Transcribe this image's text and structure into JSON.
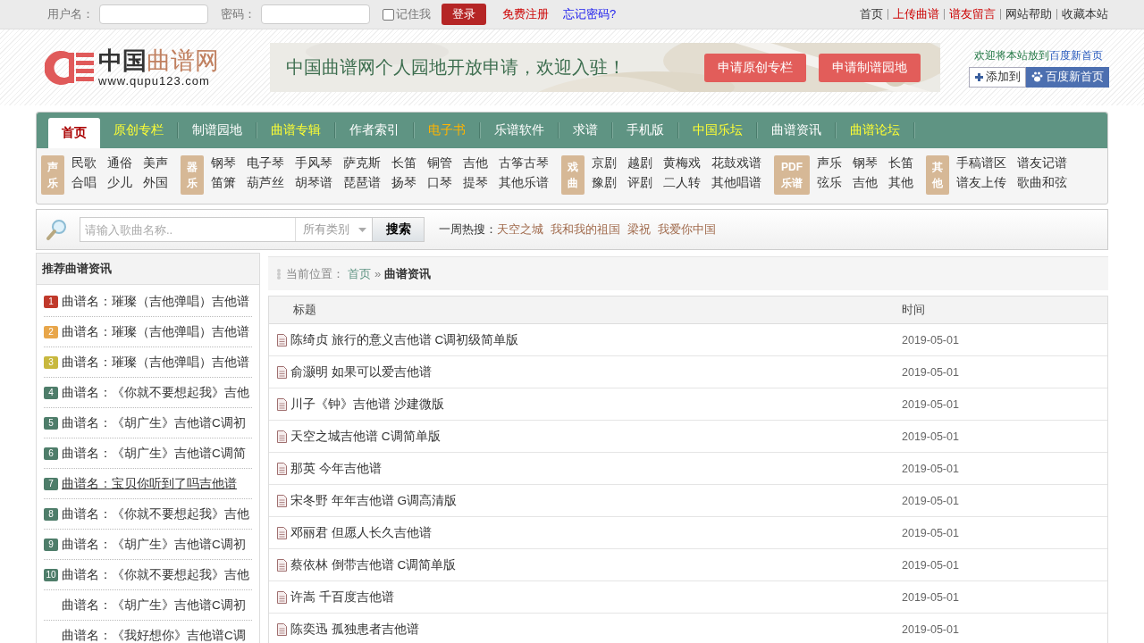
{
  "login_bar": {
    "username_label": "用户名：",
    "password_label": "密码：",
    "remember": {
      "label": "记住我",
      "checked": false
    },
    "login_button": "登录",
    "register_link": "免费注册",
    "forgot_link": "忘记密码?",
    "top_links": [
      {
        "label": "首页",
        "color": "#333333"
      },
      {
        "label": "上传曲谱",
        "color": "#cc0000"
      },
      {
        "label": "谱友留言",
        "color": "#cc0000"
      },
      {
        "label": "网站帮助",
        "color": "#333333"
      },
      {
        "label": "收藏本站",
        "color": "#333333"
      }
    ]
  },
  "header": {
    "logo_cn_1": "中国",
    "logo_cn_2": "曲谱网",
    "logo_url": "www.qupu123.com",
    "banner_text": "中国曲谱网个人园地开放申请，欢迎入驻！",
    "banner_buttons": [
      "申请原创专栏",
      "申请制谱园地"
    ],
    "homepage_text": "欢迎将本站放到",
    "homepage_link": "百度新首页",
    "add_button": "添加到",
    "baidu_button": "百度新首页"
  },
  "nav": [
    {
      "label": "首页",
      "selected": true,
      "color": "#aa0000"
    },
    {
      "label": "原创专栏",
      "selected": false,
      "color": "#ffff33"
    },
    {
      "label": "制谱园地",
      "selected": false,
      "color": "#ffffff"
    },
    {
      "label": "曲谱专辑",
      "selected": false,
      "color": "#ffff33"
    },
    {
      "label": "作者索引",
      "selected": false,
      "color": "#ffffff"
    },
    {
      "label": "电子书",
      "selected": false,
      "color": "#ffb400"
    },
    {
      "label": "乐谱软件",
      "selected": false,
      "color": "#ffffff"
    },
    {
      "label": "求谱",
      "selected": false,
      "color": "#ffffff"
    },
    {
      "label": "手机版",
      "selected": false,
      "color": "#ffffff"
    },
    {
      "label": "中国乐坛",
      "selected": false,
      "color": "#ffff33"
    },
    {
      "label": "曲谱资讯",
      "selected": false,
      "color": "#ffffff"
    },
    {
      "label": "曲谱论坛",
      "selected": false,
      "color": "#ffff33"
    }
  ],
  "categories": [
    {
      "label": [
        "声",
        "乐"
      ],
      "rows": [
        [
          "民歌",
          "通俗",
          "美声"
        ],
        [
          "合唱",
          "少儿",
          "外国"
        ]
      ]
    },
    {
      "label": [
        "器",
        "乐"
      ],
      "rows": [
        [
          "钢琴",
          "电子琴",
          "手风琴",
          "萨克斯",
          "长笛",
          "铜管",
          "吉他",
          "古筝古琴"
        ],
        [
          "笛箫",
          "葫芦丝",
          "胡琴谱",
          "琵琶谱",
          "扬琴",
          "口琴",
          "提琴",
          "其他乐谱"
        ]
      ]
    },
    {
      "label": [
        "戏",
        "曲"
      ],
      "rows": [
        [
          "京剧",
          "越剧",
          "黄梅戏",
          "花鼓戏谱"
        ],
        [
          "豫剧",
          "评剧",
          "二人转",
          "其他唱谱"
        ]
      ]
    },
    {
      "label": [
        "PDF",
        "乐谱"
      ],
      "rows": [
        [
          "声乐",
          "钢琴",
          "长笛"
        ],
        [
          "弦乐",
          "吉他",
          "其他"
        ]
      ]
    },
    {
      "label": [
        "其",
        "他"
      ],
      "rows": [
        [
          "手稿谱区",
          "谱友记谱"
        ],
        [
          "谱友上传",
          "歌曲和弦"
        ]
      ]
    }
  ],
  "search": {
    "placeholder": "请输入歌曲名称..",
    "category": "所有类别",
    "button": "搜索",
    "hot_label": "一周热搜：",
    "hot": [
      "天空之城",
      "我和我的祖国",
      "梁祝",
      "我爱你中国"
    ]
  },
  "sidebar": {
    "title": "推荐曲谱资讯",
    "items": [
      {
        "rank": "1",
        "color": "#c0392b",
        "text": "曲谱名：璀璨（吉他弹唱）吉他谱",
        "hovered": false
      },
      {
        "rank": "2",
        "color": "#e8a64a",
        "text": "曲谱名：璀璨（吉他弹唱）吉他谱",
        "hovered": false
      },
      {
        "rank": "3",
        "color": "#c8b83e",
        "text": "曲谱名：璀璨（吉他弹唱）吉他谱",
        "hovered": false
      },
      {
        "rank": "4",
        "color": "#4e7d6a",
        "text": "曲谱名：《你就不要想起我》吉他",
        "hovered": false
      },
      {
        "rank": "5",
        "color": "#4e7d6a",
        "text": "曲谱名：《胡广生》吉他谱C调初",
        "hovered": false
      },
      {
        "rank": "6",
        "color": "#4e7d6a",
        "text": "曲谱名：《胡广生》吉他谱C调简",
        "hovered": false
      },
      {
        "rank": "7",
        "color": "#4e7d6a",
        "text": "曲谱名：宝贝你听到了吗吉他谱",
        "hovered": true
      },
      {
        "rank": "8",
        "color": "#4e7d6a",
        "text": "曲谱名：《你就不要想起我》吉他",
        "hovered": false
      },
      {
        "rank": "9",
        "color": "#4e7d6a",
        "text": "曲谱名：《胡广生》吉他谱C调初",
        "hovered": false
      },
      {
        "rank": "10",
        "color": "#4e7d6a",
        "text": "曲谱名：《你就不要想起我》吉他",
        "hovered": false
      },
      {
        "text": "曲谱名：《胡广生》吉他谱C调初",
        "hovered": false
      },
      {
        "text": "曲谱名：《我好想你》吉他谱C调",
        "hovered": false
      }
    ]
  },
  "breadcrumb": {
    "label": "当前位置：",
    "home": "首页",
    "separator": "»",
    "current": "曲谱资讯"
  },
  "table": {
    "columns": [
      "标题",
      "时间"
    ],
    "rows": [
      [
        "陈绮贞 旅行的意义吉他谱 C调初级简单版",
        "2019-05-01"
      ],
      [
        "俞灏明 如果可以爱吉他谱",
        "2019-05-01"
      ],
      [
        "川子《钟》吉他谱 沙建微版",
        "2019-05-01"
      ],
      [
        "天空之城吉他谱 C调简单版",
        "2019-05-01"
      ],
      [
        "那英 今年吉他谱",
        "2019-05-01"
      ],
      [
        "宋冬野 年年吉他谱 G调高清版",
        "2019-05-01"
      ],
      [
        "邓丽君 但愿人长久吉他谱",
        "2019-05-01"
      ],
      [
        "蔡依林 倒带吉他谱 C调简单版",
        "2019-05-01"
      ],
      [
        "许嵩 千百度吉他谱",
        "2019-05-01"
      ],
      [
        "陈奕迅 孤独患者吉他谱",
        "2019-05-01"
      ]
    ]
  }
}
